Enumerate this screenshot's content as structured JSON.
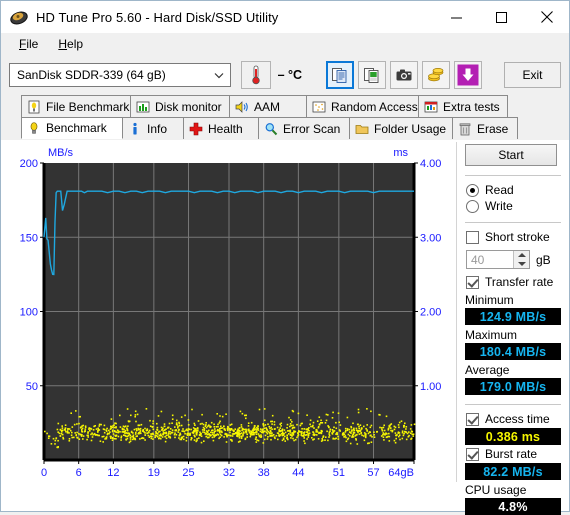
{
  "window": {
    "title": "HD Tune Pro 5.60 - Hard Disk/SSD Utility",
    "icon": "hard-disk-icon",
    "minimize": "minimize-icon",
    "maximize": "maximize-icon",
    "close": "close-icon"
  },
  "menu": {
    "items": [
      "File",
      "Help"
    ]
  },
  "toolbar": {
    "drive": "SanDisk SDDR-339 (64 gB)",
    "temperature": "– °C",
    "thermometer_icon": "thermometer-icon",
    "buttons": [
      {
        "name": "copy-text-button",
        "icon": "copy-text-icon",
        "selected": true
      },
      {
        "name": "copy-image-button",
        "icon": "copy-image-icon",
        "selected": false
      },
      {
        "name": "screenshot-button",
        "icon": "camera-icon",
        "selected": false
      },
      {
        "name": "donate-button",
        "icon": "coins-icon",
        "selected": false
      },
      {
        "name": "save-button",
        "icon": "download-arrow-icon",
        "selected": false
      }
    ],
    "exit_label": "Exit"
  },
  "tabs": {
    "row1": [
      {
        "label": "File Benchmark",
        "icon": "file-benchmark-icon"
      },
      {
        "label": "Disk monitor",
        "icon": "disk-monitor-icon"
      },
      {
        "label": "AAM",
        "icon": "speaker-icon"
      },
      {
        "label": "Random Access",
        "icon": "random-access-icon"
      },
      {
        "label": "Extra tests",
        "icon": "extra-tests-icon"
      }
    ],
    "row2": [
      {
        "label": "Benchmark",
        "icon": "bulb-icon",
        "active": true
      },
      {
        "label": "Info",
        "icon": "info-icon",
        "active": false
      },
      {
        "label": "Health",
        "icon": "health-cross-icon",
        "active": false
      },
      {
        "label": "Error Scan",
        "icon": "magnifier-icon",
        "active": false
      },
      {
        "label": "Folder Usage",
        "icon": "folder-icon",
        "active": false
      },
      {
        "label": "Erase",
        "icon": "trash-icon",
        "active": false
      }
    ]
  },
  "panel": {
    "start_label": "Start",
    "mode": {
      "read_label": "Read",
      "write_label": "Write",
      "selected": "Read"
    },
    "short_stroke": {
      "label": "Short stroke",
      "checked": false,
      "value": "40",
      "unit": "gB"
    },
    "transfer_rate": {
      "label": "Transfer rate",
      "checked": true
    },
    "minimum": {
      "label": "Minimum",
      "value": "124.9 MB/s"
    },
    "maximum": {
      "label": "Maximum",
      "value": "180.4 MB/s"
    },
    "average": {
      "label": "Average",
      "value": "179.0 MB/s"
    },
    "access_time": {
      "label": "Access time",
      "checked": true,
      "value": "0.386 ms"
    },
    "burst_rate": {
      "label": "Burst rate",
      "checked": true,
      "value": "82.2 MB/s"
    },
    "cpu_usage": {
      "label": "CPU usage",
      "value": "4.8%"
    }
  },
  "chart_data": {
    "type": "line",
    "title": "",
    "ylabel": "MB/s",
    "y2label": "ms",
    "xlabel": "",
    "background": "#333333",
    "grid": true,
    "grid_color": "#787878",
    "xlim": [
      0,
      64
    ],
    "xticks": [
      0,
      6,
      12,
      19,
      25,
      32,
      38,
      44,
      51,
      57,
      64
    ],
    "xticklabels": [
      "0",
      "6",
      "12",
      "19",
      "25",
      "32",
      "38",
      "44",
      "51",
      "57",
      "64gB"
    ],
    "ylim": [
      0,
      200
    ],
    "yticks": [
      50,
      100,
      150,
      200
    ],
    "yticklabels": [
      "50",
      "100",
      "150",
      "200"
    ],
    "y2lim": [
      0,
      4
    ],
    "y2ticks": [
      1.0,
      2.0,
      3.0,
      4.0
    ],
    "y2ticklabels": [
      "1.00",
      "2.00",
      "3.00",
      "4.00"
    ],
    "series": [
      {
        "name": "Transfer rate",
        "type": "line",
        "color": "#1fa8e0",
        "axis": "left",
        "unit": "MB/s",
        "x": [
          0.0,
          0.3,
          0.5,
          0.7,
          0.9,
          1.1,
          1.3,
          1.5,
          1.7,
          1.9,
          2.1,
          2.3,
          2.5,
          2.7,
          2.9,
          3.2,
          3.5,
          4.0,
          4.5,
          5.0,
          5.5,
          6.0,
          6.5,
          7.0,
          7.5,
          8.0,
          8.5,
          9.0,
          9.5,
          10.0,
          11.0,
          12.0,
          13.0,
          14.0,
          15.0,
          16.0,
          17.0,
          18.0,
          19.0,
          20.0,
          21.0,
          22.0,
          23.0,
          24.0,
          25.0,
          26.0,
          27.0,
          28.0,
          29.0,
          30.0,
          31.0,
          32.0,
          33.0,
          34.0,
          35.0,
          36.0,
          37.0,
          38.0,
          39.0,
          40.0,
          41.0,
          42.0,
          43.0,
          44.0,
          45.0,
          46.0,
          47.0,
          48.0,
          49.0,
          50.0,
          51.0,
          52.0,
          53.0,
          54.0,
          55.0,
          56.0,
          57.0,
          58.0,
          59.0,
          60.0,
          61.0,
          62.0,
          63.0,
          64.0
        ],
        "y": [
          150,
          163,
          149,
          148,
          140,
          132,
          128,
          125,
          124.9,
          160,
          180,
          181,
          181,
          181,
          181,
          168,
          172,
          181,
          181,
          181,
          181,
          181,
          181,
          180,
          181,
          181,
          181,
          181,
          181,
          181,
          180,
          181,
          181,
          180,
          181,
          181,
          180,
          181,
          181,
          181,
          180,
          181,
          181,
          181,
          181,
          180,
          181,
          181,
          181,
          180,
          181,
          181,
          180,
          181,
          181,
          181,
          180,
          181,
          181,
          181,
          180,
          181,
          181,
          180,
          181,
          181,
          181,
          180,
          181,
          181,
          181,
          180,
          181,
          181,
          181,
          181,
          180,
          181,
          181,
          181,
          181,
          181,
          181,
          181
        ]
      },
      {
        "name": "Access time",
        "type": "scatter",
        "color": "#f7f700",
        "axis": "right",
        "unit": "ms",
        "mean": 0.386,
        "range": [
          0.18,
          0.7
        ],
        "density_note": "dense 0-40 gB, sparse 40-64 gB"
      }
    ]
  }
}
